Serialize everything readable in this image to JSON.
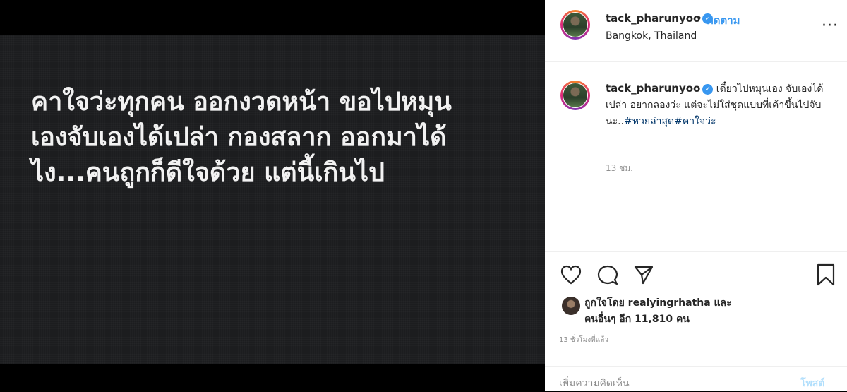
{
  "post": {
    "text_lines": [
      "คาใจว่ะทุกคน ออกงวดหน้า ขอไปหมุน",
      "เองจับเองได้เปล่า กองสลาก ออกมาได้",
      "ไง...คนถูกก็ดีใจด้วย แต่นี้เกินไป"
    ]
  },
  "header": {
    "username": "tack_pharunyoo",
    "verified_icon": "verified-badge-icon",
    "separator": "•",
    "follow_label": "ติดตาม",
    "location": "Bangkok, Thailand",
    "more_icon": "more-options-icon",
    "more_glyph": "···"
  },
  "caption": {
    "username": "tack_pharunyoo",
    "text": "เดี๋ยวไปหมุนเอง จับเองได้เปล่า อยากลองว่ะ แต่จะไม่ใส่ชุดแบบที่เค้าขึ้นไปจับนะ..",
    "hashtags": "#หวยล่าสุด#คาใจว่ะ",
    "time": "13 ชม."
  },
  "actions": {
    "like_icon": "heart-icon",
    "comment_icon": "comment-icon",
    "share_icon": "share-icon",
    "save_icon": "bookmark-icon"
  },
  "likes": {
    "line1": "ถูกใจโดย realyingrhatha และ",
    "line2": "คนอื่นๆ อีก 11,810 คน"
  },
  "time_ago": "13 ชั่วโมงที่แล้ว",
  "comment": {
    "placeholder": "เพิ่มความคิดเห็น",
    "post_label": "โพสต์"
  },
  "colors": {
    "accent": "#3897f0",
    "hashtag": "#003569",
    "post_button_disabled": "#b2dffc",
    "image_background": "#1c1d1f"
  }
}
